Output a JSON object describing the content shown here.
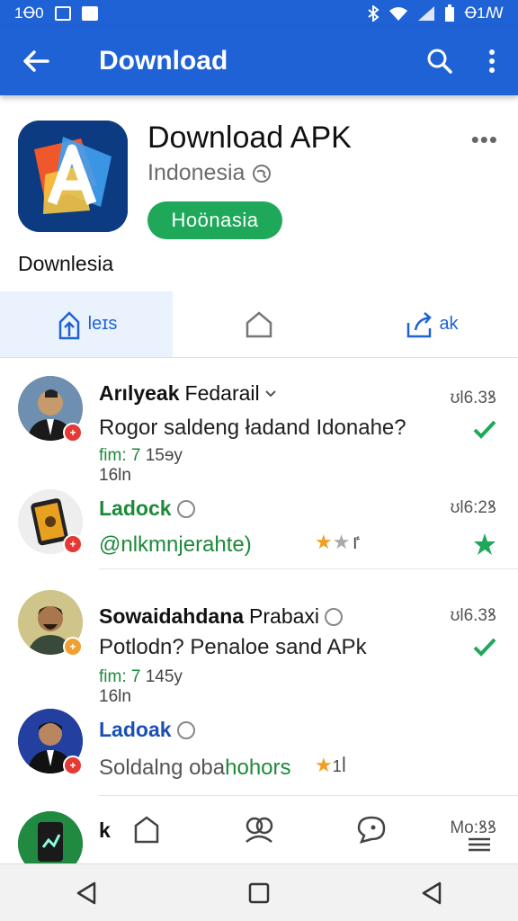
{
  "status_bar": {
    "time": "1Ꝋ0",
    "right_text": "Ꝋ1ꟿ"
  },
  "app_bar": {
    "title": "Download"
  },
  "app": {
    "name": "Download APK",
    "region": "Indonesia",
    "pill": "Hoönasia",
    "caption": "Downlesia"
  },
  "tabs": [
    {
      "label": "leɪs"
    },
    {
      "label": ""
    },
    {
      "label": "ak"
    }
  ],
  "items": [
    {
      "name_bold": "Arılyeak",
      "name_rest": "Fedarail",
      "time": "ʊl6.3ꝸ",
      "message": "Rogor saldeng ładand Idonahe?",
      "meta_a": "fim: 7",
      "meta_b": "15ɘy",
      "meta_c": "16ln"
    },
    {
      "name": "Ladock",
      "time": "ʊl6:2ꝸ",
      "message": "@nlkmnjerahte)",
      "rating": "ٵ"
    },
    {
      "name_bold": "Sowaidahdana",
      "name_rest": "Prabaxi",
      "time": "ʊl6.3ꝸ",
      "message": "Potlodn? Penaloe sand APk",
      "meta_a": "fim: 7",
      "meta_b": "145y",
      "meta_c": "16ln"
    },
    {
      "name": "Ladoak",
      "message_a": "Soldalng oba",
      "message_b": "hohors",
      "rating": "1ꟾ"
    },
    {
      "name": "k",
      "time": "Mo:ꝸꝸ"
    }
  ],
  "colors": {
    "primary": "#1f62d6",
    "green": "#1fa85a",
    "star": "#f0a020",
    "badge_red": "#e53935"
  }
}
